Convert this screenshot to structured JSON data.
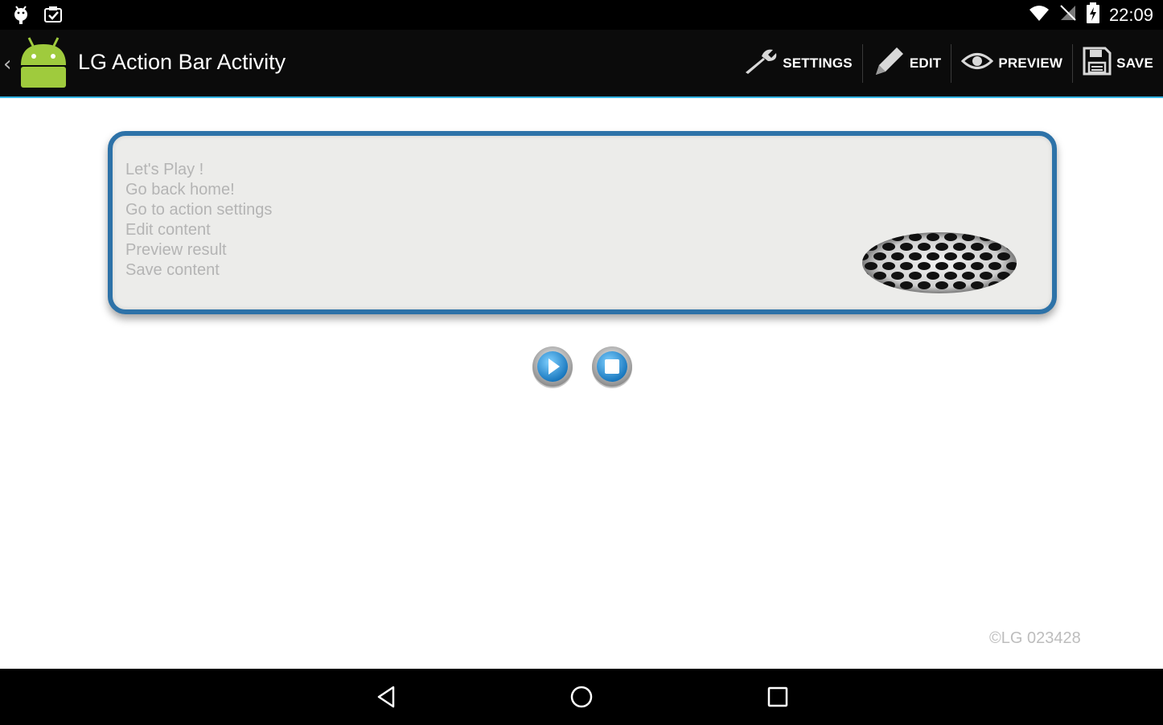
{
  "status_bar": {
    "time": "22:09",
    "left_icons": [
      "android-notify-icon",
      "clipboard-check-icon"
    ],
    "right_icons": [
      "wifi-icon",
      "no-signal-icon",
      "battery-charging-icon"
    ]
  },
  "action_bar": {
    "title": "LG Action Bar Activity",
    "accent_color": "#33b5e5",
    "actions": [
      {
        "label": "SETTINGS",
        "icon": "wrench-icon"
      },
      {
        "label": "EDIT",
        "icon": "pencil-icon"
      },
      {
        "label": "PREVIEW",
        "icon": "eye-icon"
      },
      {
        "label": "SAVE",
        "icon": "floppy-disk-icon"
      }
    ]
  },
  "card": {
    "border_color": "#2d72a8",
    "lines": [
      "Let's Play !",
      "Go back home!",
      "Go to action settings",
      "Edit content",
      "Preview result",
      "Save content"
    ]
  },
  "controls": {
    "play_icon": "play-icon",
    "stop_icon": "stop-icon"
  },
  "footer": {
    "copyright": "©LG 023428"
  },
  "nav_bar": {
    "icons": [
      "back-icon",
      "home-icon",
      "recents-icon"
    ]
  }
}
